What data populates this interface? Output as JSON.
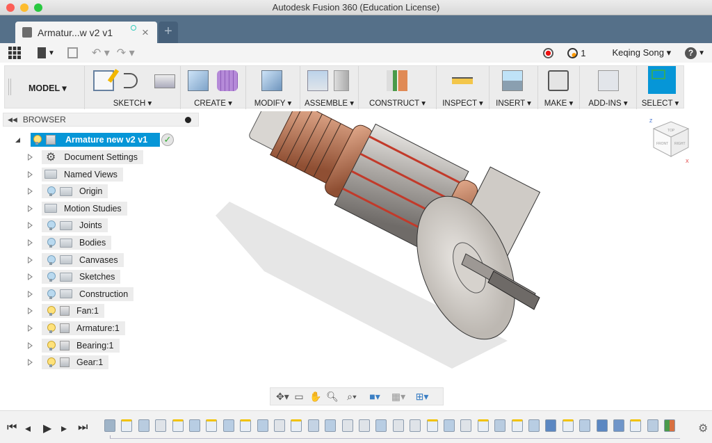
{
  "window": {
    "title": "Autodesk Fusion 360 (Education License)"
  },
  "tab": {
    "label": "Armatur...w v2 v1",
    "new_tab": "+",
    "close": "×"
  },
  "qat": {
    "job_count": "1",
    "user": "Keqing Song ▾",
    "help": "?"
  },
  "ribbon": {
    "workspace": "MODEL ▾",
    "groups": [
      {
        "label": "SKETCH ▾"
      },
      {
        "label": "CREATE ▾"
      },
      {
        "label": "MODIFY ▾"
      },
      {
        "label": "ASSEMBLE ▾"
      },
      {
        "label": "CONSTRUCT ▾"
      },
      {
        "label": "INSPECT ▾"
      },
      {
        "label": "INSERT ▾"
      },
      {
        "label": "MAKE ▾"
      },
      {
        "label": "ADD-INS ▾"
      },
      {
        "label": "SELECT ▾"
      }
    ]
  },
  "browser": {
    "title": "BROWSER",
    "root": "Armature new v2 v1",
    "items": [
      {
        "label": "Document Settings",
        "icon": "gear",
        "bulb": "none"
      },
      {
        "label": "Named Views",
        "icon": "folder",
        "bulb": "none"
      },
      {
        "label": "Origin",
        "icon": "folder",
        "bulb": "off"
      },
      {
        "label": "Motion Studies",
        "icon": "folder",
        "bulb": "none"
      },
      {
        "label": "Joints",
        "icon": "folder",
        "bulb": "off"
      },
      {
        "label": "Bodies",
        "icon": "folder",
        "bulb": "off"
      },
      {
        "label": "Canvases",
        "icon": "folder",
        "bulb": "off"
      },
      {
        "label": "Sketches",
        "icon": "folder",
        "bulb": "off"
      },
      {
        "label": "Construction",
        "icon": "folder",
        "bulb": "off"
      },
      {
        "label": "Fan:1",
        "icon": "component",
        "bulb": "on"
      },
      {
        "label": "Armature:1",
        "icon": "component",
        "bulb": "on"
      },
      {
        "label": "Bearing:1",
        "icon": "component",
        "bulb": "on"
      },
      {
        "label": "Gear:1",
        "icon": "component",
        "bulb": "on"
      }
    ]
  },
  "viewcube": {
    "top": "TOP",
    "front": "FRONT",
    "right": "RIGHT",
    "axis_z": "Z",
    "axis_x": "X"
  },
  "timeline": {
    "features": [
      "canvas",
      "sketch",
      "revolve",
      "chamfer",
      "sketch",
      "extrude",
      "sketch",
      "extrude",
      "sketch",
      "extrude",
      "chamfer",
      "sketch",
      "patch",
      "extrude",
      "chamfer",
      "chamfer",
      "extrude",
      "chamfer",
      "chamfer",
      "sketch",
      "extrude",
      "chamfer",
      "sketch",
      "revolve",
      "sketch",
      "extrude",
      "move",
      "sketch",
      "extrude",
      "move",
      "split",
      "sketch",
      "revolve",
      "construct"
    ]
  },
  "colors": {
    "accent": "#0696d7",
    "tabbar": "#557089",
    "copper": "#c9825f"
  }
}
